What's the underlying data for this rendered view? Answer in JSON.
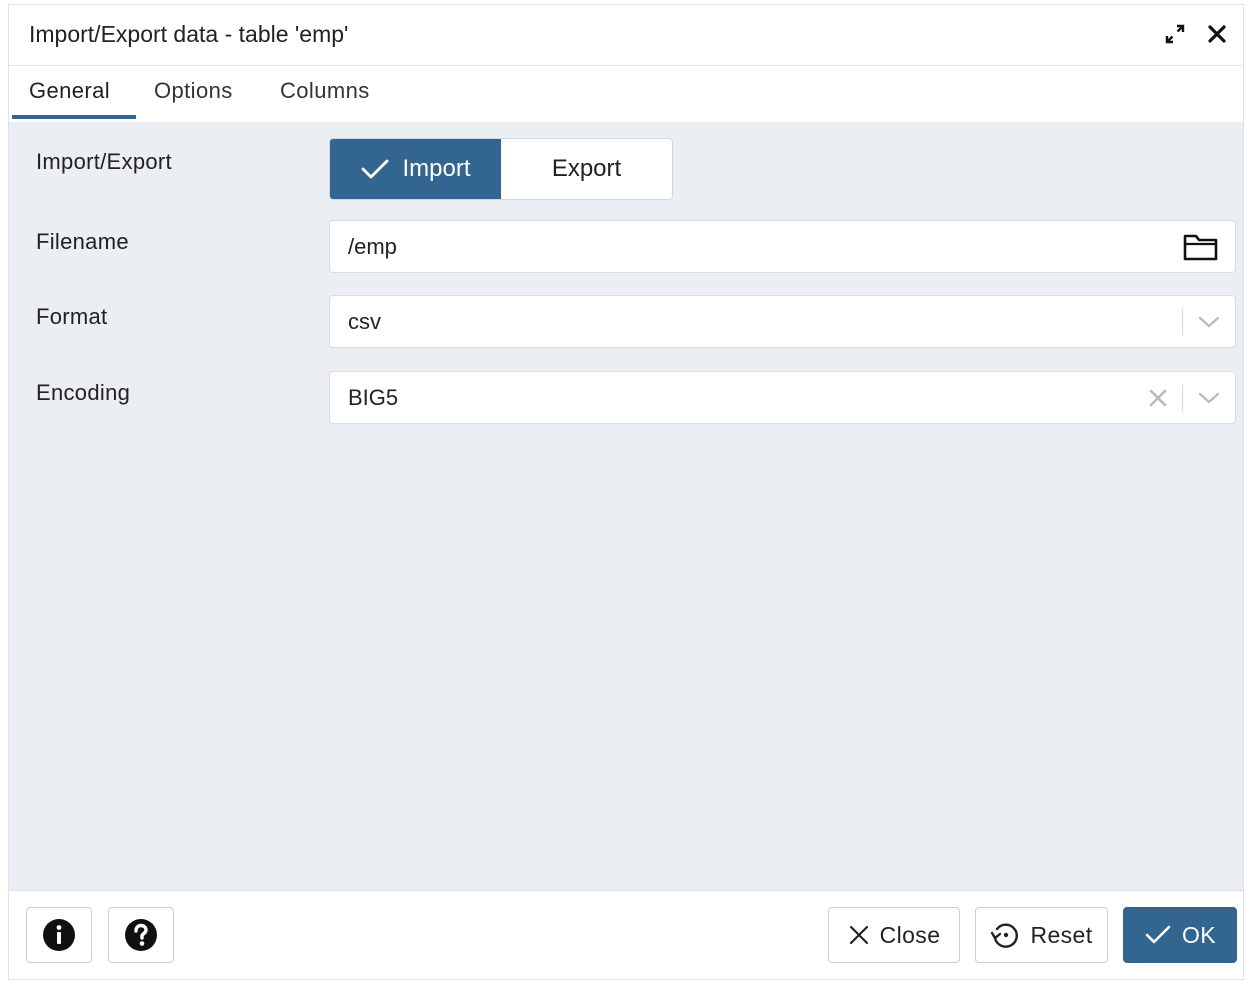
{
  "dialog": {
    "title": "Import/Export data - table 'emp'",
    "icons": [
      "expand-icon",
      "close-icon"
    ]
  },
  "tabs": [
    {
      "label": "General",
      "active": true
    },
    {
      "label": "Options",
      "active": false
    },
    {
      "label": "Columns",
      "active": false
    }
  ],
  "form": {
    "import_export": {
      "label": "Import/Export",
      "options": [
        "Import",
        "Export"
      ],
      "selected": "Import"
    },
    "filename": {
      "label": "Filename",
      "value": "/emp",
      "icon": "folder-icon"
    },
    "format": {
      "label": "Format",
      "value": "csv",
      "icon": "chevron-down-icon"
    },
    "encoding": {
      "label": "Encoding",
      "value": "BIG5",
      "icons": [
        "clear-icon",
        "chevron-down-icon"
      ]
    }
  },
  "footer": {
    "info_icon": "info-icon",
    "help_icon": "help-icon",
    "close_label": "Close",
    "reset_label": "Reset",
    "ok_label": "OK"
  },
  "colors": {
    "accent": "#326690",
    "content_bg": "#ebeef3"
  }
}
